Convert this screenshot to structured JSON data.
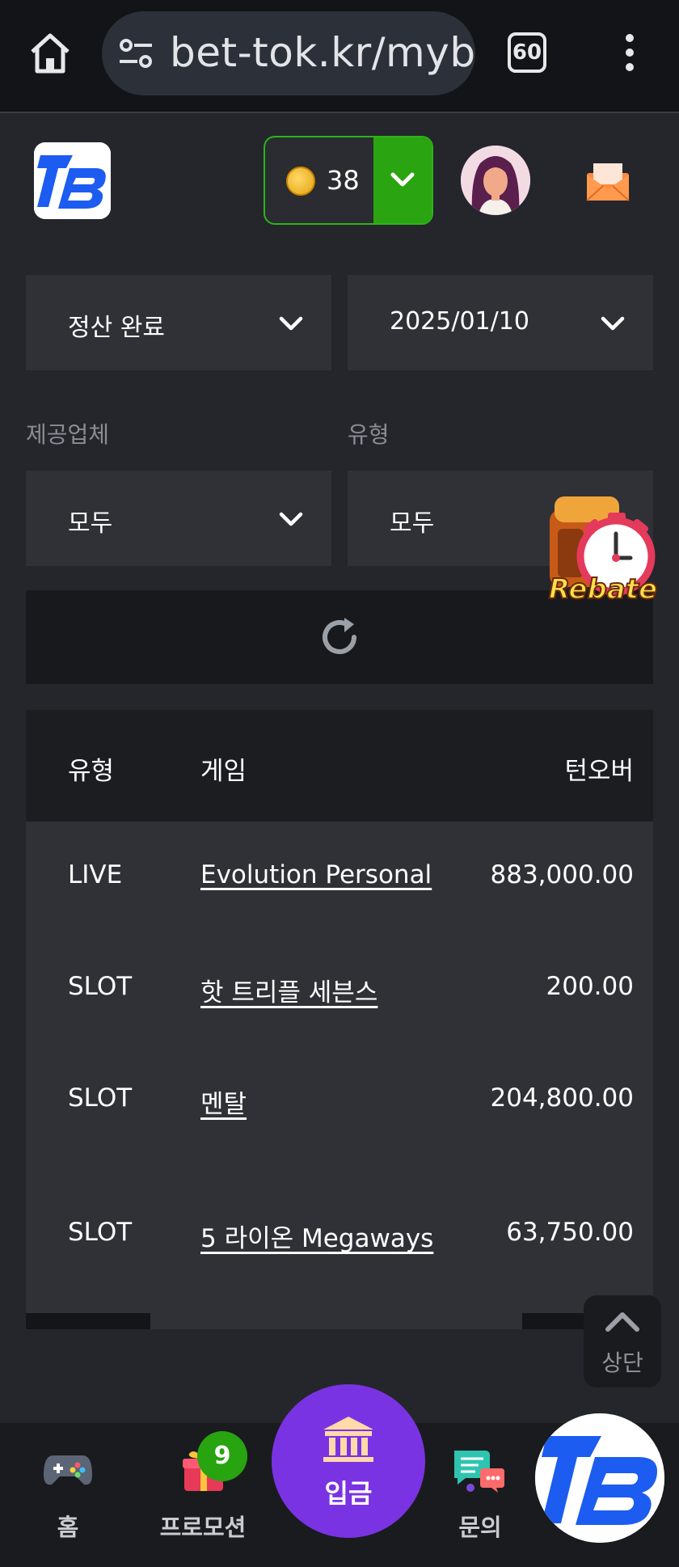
{
  "browser": {
    "url": "bet-tok.kr/mybe",
    "tab_count": "60"
  },
  "header": {
    "logo_text": "TB",
    "balance": "38"
  },
  "filters": {
    "status": "정산 완료",
    "date": "2025/01/10",
    "provider_label": "제공업체",
    "provider_value": "모두",
    "type_label": "유형",
    "type_value": "모두"
  },
  "rebate_label": "Rebate",
  "table": {
    "headers": [
      "유형",
      "게임",
      "턴오버"
    ],
    "rows": [
      {
        "type": "LIVE",
        "game": "Evolution Personal",
        "turnover": "883,000.00"
      },
      {
        "type": "SLOT",
        "game": "핫 트리플 세븐스",
        "turnover": "200.00"
      },
      {
        "type": "SLOT",
        "game": "멘탈",
        "turnover": "204,800.00"
      },
      {
        "type": "SLOT",
        "game": "5 라이온 Megaways",
        "turnover": "63,750.00"
      }
    ]
  },
  "scroll_top_label": "상단",
  "nav": {
    "home": "홈",
    "promotions": "프로모션",
    "promotions_badge": "9",
    "deposit": "입금",
    "inquiry": "문의"
  }
}
